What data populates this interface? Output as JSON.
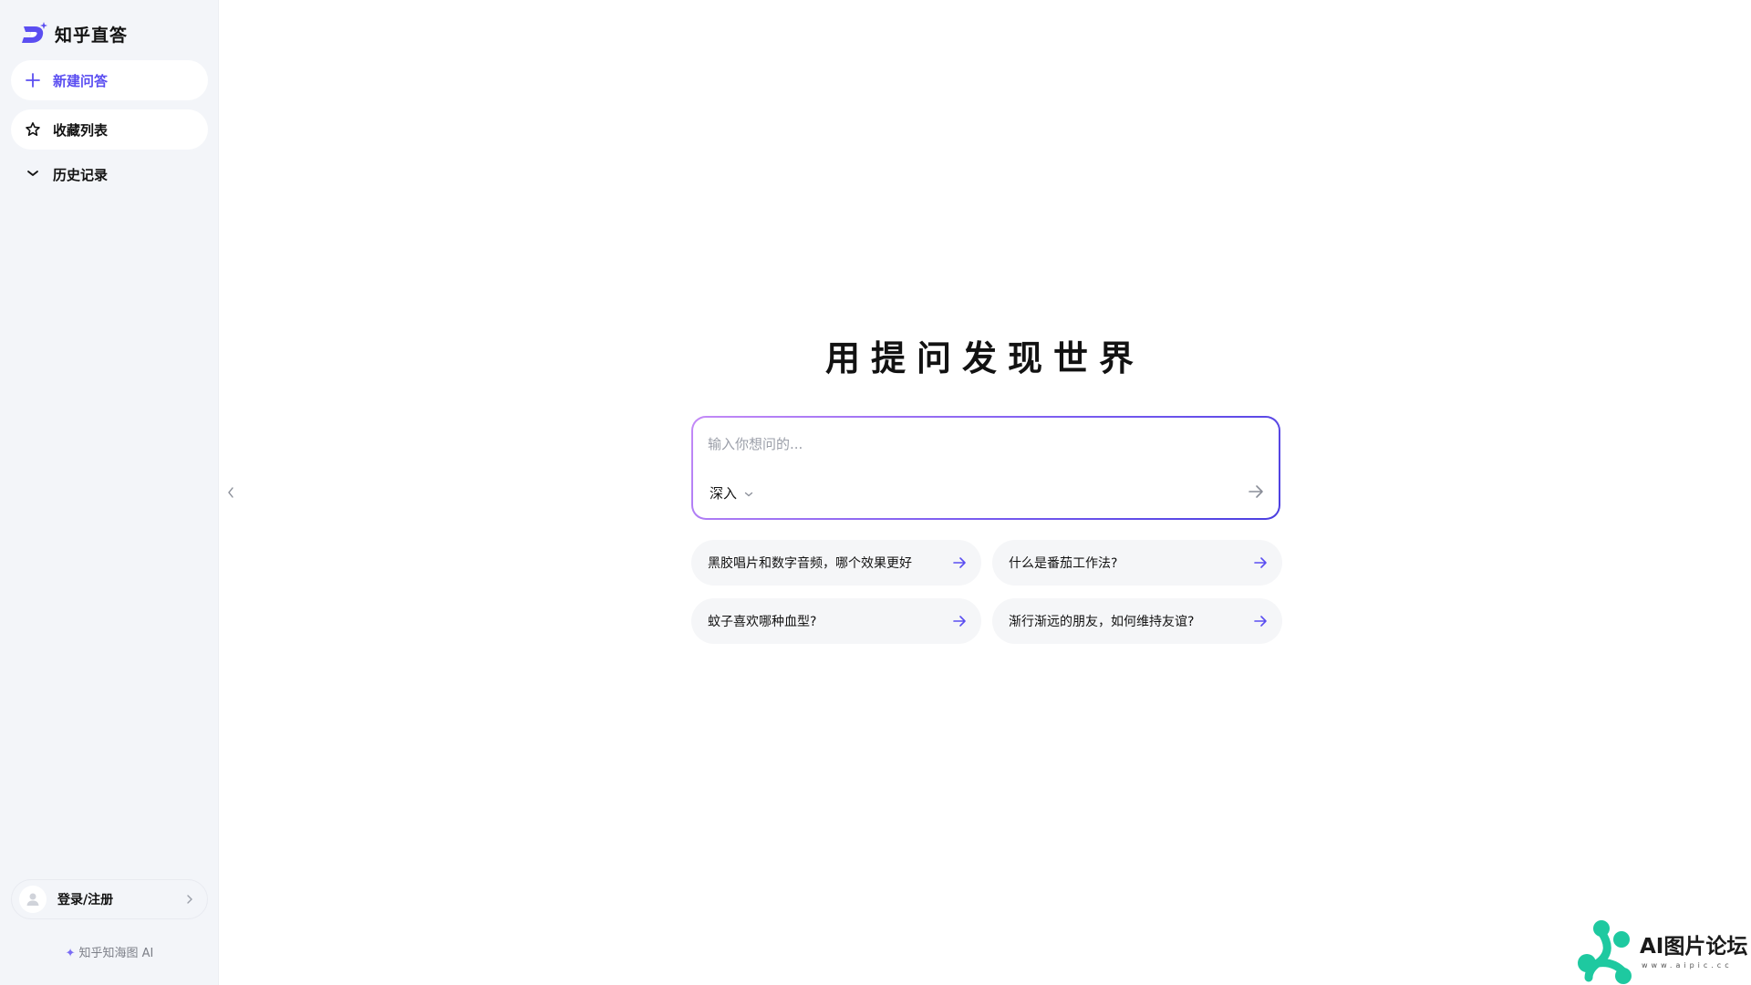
{
  "app": {
    "name": "知乎直答"
  },
  "sidebar": {
    "new_label": "新建问答",
    "favorites_label": "收藏列表",
    "history_label": "历史记录",
    "login_label": "登录/注册",
    "footer": "知乎知海图 AI"
  },
  "main": {
    "hero": "用提问发现世界",
    "input_placeholder": "输入你想问的...",
    "mode_label": "深入",
    "suggestions": [
      "黑胶唱片和数字音频，哪个效果更好",
      "什么是番茄工作法?",
      "蚊子喜欢哪种血型?",
      "渐行渐远的朋友，如何维持友谊?"
    ]
  },
  "watermark": {
    "text": "AI图片论坛",
    "sub": "www.aipic.cc"
  },
  "colors": {
    "accent": "#5b4ef1",
    "sidebar_bg": "#f3f5f9",
    "card_bg": "#f5f6f8",
    "watermark_teal": "#1ec9a0"
  }
}
